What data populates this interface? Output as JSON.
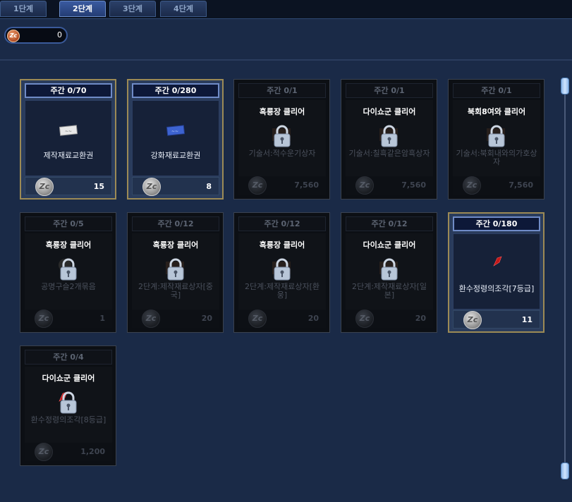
{
  "tabs": [
    {
      "label": "1단계",
      "active": false
    },
    {
      "label": "2단계",
      "active": true
    },
    {
      "label": "3단계",
      "active": false
    },
    {
      "label": "4단계",
      "active": false
    }
  ],
  "currency": {
    "coin_icon": "coin-icon",
    "amount": "0"
  },
  "cards": [
    {
      "limit": "주간 0/70",
      "name": "제작재료교환권",
      "price": "15",
      "active": true,
      "icon": "ticket-icon",
      "req": ""
    },
    {
      "limit": "주간 0/280",
      "name": "강화재료교환권",
      "price": "8",
      "active": true,
      "icon": "blue-ticket-icon",
      "req": ""
    },
    {
      "limit": "주간 0/1",
      "name": "기술서:적수운기상자",
      "price": "7,560",
      "active": false,
      "icon": "box-icon",
      "req": "흑룡장 클리어"
    },
    {
      "limit": "주간 0/1",
      "name": "기술서:칠흑같은암흑상자",
      "price": "7,560",
      "active": false,
      "icon": "box-icon",
      "req": "다이쇼군 클리어"
    },
    {
      "limit": "주간 0/1",
      "name": "기술서:북회내와의가호상자",
      "price": "7,560",
      "active": false,
      "icon": "box-icon",
      "req": "북회8여와 클리어"
    },
    {
      "limit": "주간 0/5",
      "name": "공명구슬2개묶음",
      "price": "1",
      "active": false,
      "icon": "orb-icon",
      "req": "흑룡장 클리어"
    },
    {
      "limit": "주간 0/12",
      "name": "2단계:제작재료상자[중국]",
      "price": "20",
      "active": false,
      "icon": "box-icon",
      "req": "흑룡장 클리어"
    },
    {
      "limit": "주간 0/12",
      "name": "2단계:제작재료상자[환웅]",
      "price": "20",
      "active": false,
      "icon": "box-icon",
      "req": "흑룡장 클리어"
    },
    {
      "limit": "주간 0/12",
      "name": "2단계:제작재료상자[일본]",
      "price": "20",
      "active": false,
      "icon": "box-icon",
      "req": "다이쇼군 클리어"
    },
    {
      "limit": "주간 0/180",
      "name": "환수정령의조각[7등급]",
      "price": "11",
      "active": true,
      "icon": "red-shard-icon",
      "req": ""
    },
    {
      "limit": "주간 0/4",
      "name": "환수정령의조각[8등급]",
      "price": "1,200",
      "active": false,
      "icon": "red-shard-icon",
      "req": "다이쇼군 클리어"
    }
  ],
  "colors": {
    "accent_border": "#9c8a55",
    "header_border": "#6f8bc7",
    "currency_coin": "#c0562a"
  }
}
